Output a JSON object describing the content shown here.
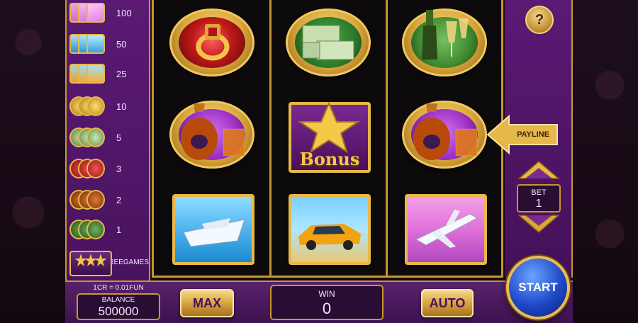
{
  "paytable": {
    "rows": [
      {
        "value": "100",
        "symbol": "airplane-icon"
      },
      {
        "value": "50",
        "symbol": "yacht-icon"
      },
      {
        "value": "25",
        "symbol": "sports-car-icon"
      },
      {
        "value": "10",
        "symbol": "gold-bars-icon"
      },
      {
        "value": "5",
        "symbol": "money-stack-icon"
      },
      {
        "value": "3",
        "symbol": "ring-icon"
      },
      {
        "value": "2",
        "symbol": "cognac-icon"
      },
      {
        "value": "1",
        "symbol": "champagne-icon"
      }
    ],
    "freegames": {
      "label": "FREEGAMES",
      "symbol": "bonus-star-icon"
    }
  },
  "reels": {
    "row1": [
      "ring-icon",
      "money-stack-icon",
      "champagne-icon"
    ],
    "row2": [
      "cognac-icon",
      "bonus-star-icon",
      "cognac-icon"
    ],
    "row3": [
      "yacht-icon",
      "sports-car-icon",
      "airplane-icon"
    ],
    "bonus_text": "Bonus"
  },
  "controls": {
    "help_label": "?",
    "payline_label": "PAYLINE",
    "bet_label": "BET",
    "bet_value": "1",
    "cr_text": "1CR = 0.01FUN",
    "balance_label": "BALANCE",
    "balance_value": "500000",
    "max_label": "MAX",
    "win_label": "WIN",
    "win_value": "0",
    "auto_label": "AUTO",
    "start_label": "START"
  },
  "colors": {
    "gold": "#c9962e",
    "purple": "#5a1a73",
    "start_blue": "#1f48c8"
  }
}
